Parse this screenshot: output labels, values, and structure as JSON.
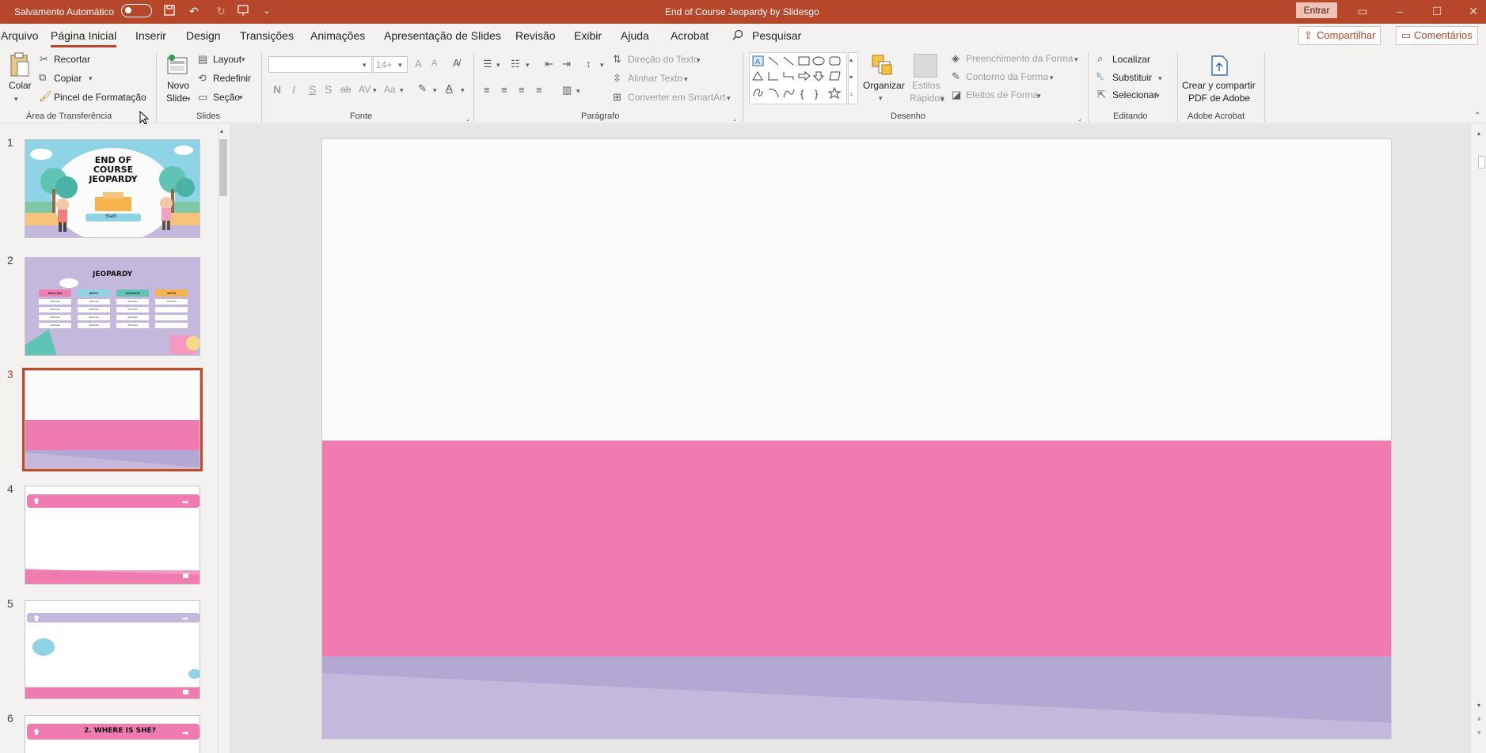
{
  "titlebar": {
    "autosave_label": "Salvamento Automático",
    "document_title": "End of Course Jeopardy by Slidesgo",
    "signin_label": "Entrar"
  },
  "menu": {
    "items": [
      "Arquivo",
      "Página Inicial",
      "Inserir",
      "Design",
      "Transições",
      "Animações",
      "Apresentação de Slides",
      "Revisão",
      "Exibir",
      "Ajuda",
      "Acrobat"
    ],
    "active": "Página Inicial",
    "search_label": "Pesquisar",
    "share_label": "Compartilhar",
    "comments_label": "Comentários"
  },
  "ribbon": {
    "clipboard": {
      "paste": "Colar",
      "cut": "Recortar",
      "copy": "Copiar",
      "format_painter": "Pincel de Formatação",
      "group": "Área de Transferência"
    },
    "slides": {
      "new_slide_1": "Novo",
      "new_slide_2": "Slide",
      "layout": "Layout",
      "reset": "Redefinir",
      "section": "Seção",
      "group": "Slides"
    },
    "font": {
      "font_name": "",
      "font_size": "14+",
      "bold": "N",
      "italic": "I",
      "underline": "S",
      "shadow": "S",
      "strike": "ab",
      "spacing": "AV",
      "case": "Aa",
      "grow": "A",
      "shrink": "A",
      "group": "Fonte"
    },
    "paragraph": {
      "text_direction": "Direção do Texto",
      "align_text": "Alinhar Texto",
      "smartart": "Converter em SmartArt",
      "group": "Parágrafo"
    },
    "drawing": {
      "arrange": "Organizar",
      "quick_styles_1": "Estilos",
      "quick_styles_2": "Rápidos",
      "shape_fill": "Preenchimento da Forma",
      "shape_outline": "Contorno da Forma",
      "shape_effects": "Efeitos de Forma",
      "group": "Desenho"
    },
    "editing": {
      "find": "Localizar",
      "replace": "Substituir",
      "select": "Selecionar",
      "group": "Editando"
    },
    "acrobat": {
      "create_1": "Crear y compartir",
      "create_2": "PDF de Adobe",
      "group": "Adobe Acrobat"
    }
  },
  "thumbnails": {
    "numbers": [
      "1",
      "2",
      "3",
      "4",
      "5",
      "6"
    ],
    "selected": "3",
    "slide1": {
      "line1": "END OF",
      "line2": "COURSE",
      "line3": "JEOPARDY",
      "start": "Start!"
    },
    "slide2": {
      "title": "JEOPARDY",
      "categories": [
        "ENGLISH",
        "MATH",
        "SCIENCE",
        "ARTS"
      ],
      "cells": [
        "10 Points",
        "20 Points",
        "30 Points",
        "40 Points"
      ]
    },
    "slide6": {
      "title": "2. WHERE IS SHE?"
    }
  },
  "colors": {
    "accent": "#b7472a",
    "slide_pink": "#ef7bb0",
    "slide_lilac": "#b3a8d4",
    "slide_lilac_light": "#c4b9dc"
  }
}
